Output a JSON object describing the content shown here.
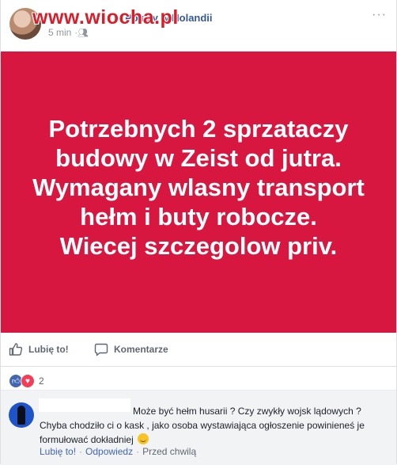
{
  "header": {
    "group_name": "Polacy w Holandii",
    "timestamp": "5 min",
    "audience_icon": "group-icon",
    "watermark": "www.wiocha.pl",
    "options_icon": "more-options-icon"
  },
  "post_image": {
    "text": "Potrzebnych 2 sprzataczy\nbudowy w Zeist od jutra.\nWymagany wlasny transport\nhełm i buty robocze.\nWiecej szczegolow priv.",
    "background_color": "#d7173f"
  },
  "actions": {
    "like_label": "Lubię to!",
    "comment_label": "Komentarze"
  },
  "reactions": {
    "icons": [
      "like-reaction-icon",
      "love-reaction-icon"
    ],
    "count": "2"
  },
  "comment": {
    "text": "Może być hełm husarii ? Czy zwykły wojsk lądowych ? Chyba chodziło ci o kask , jako osoba wystawiająca ogłoszenie powinieneś je formułować dokładniej",
    "emoji": "smile-emoji-icon",
    "like_label": "Lubię to!",
    "reply_label": "Odpowiedz",
    "time_label": "Przed chwilą",
    "separator": "·"
  }
}
